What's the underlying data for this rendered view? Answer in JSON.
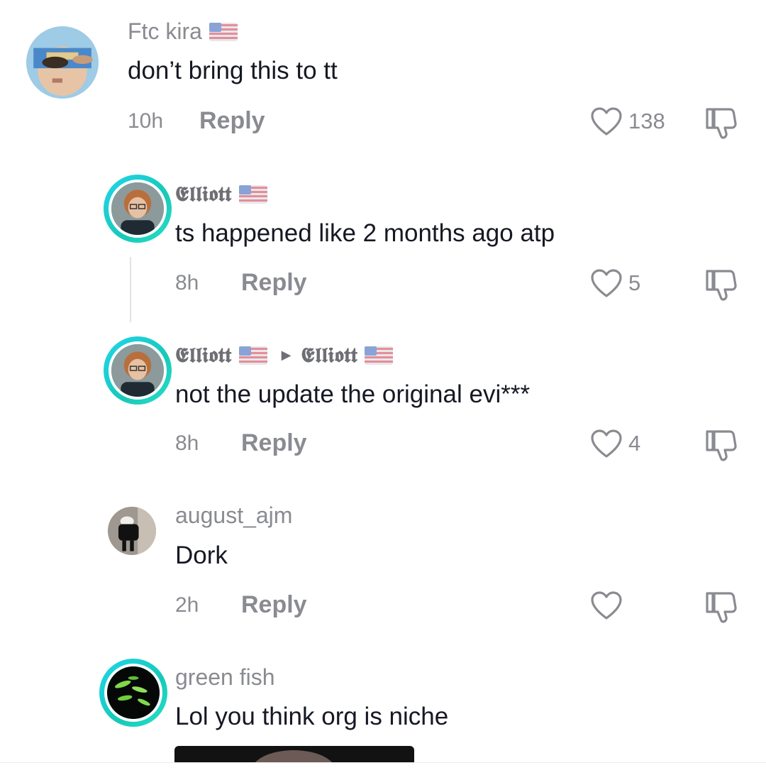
{
  "comments": [
    {
      "username": "Ftc kira",
      "flag": "us-flag",
      "text": "don’t bring this to tt",
      "time": "10h",
      "reply_label": "Reply",
      "likes": "138"
    },
    {
      "username": "𝕰𝖑𝖑𝖎𝖔𝖙𝖙",
      "flag": "us-flag",
      "text": "ts happened like 2 months ago atp",
      "time": "8h",
      "reply_label": "Reply",
      "likes": "5"
    },
    {
      "username": "𝕰𝖑𝖑𝖎𝖔𝖙𝖙",
      "reply_to": "𝕰𝖑𝖑𝖎𝖔𝖙𝖙",
      "flag": "us-flag",
      "text": "not the update the original evi***",
      "time": "8h",
      "reply_label": "Reply",
      "likes": "4"
    },
    {
      "username": "august_ajm",
      "text": "Dork",
      "time": "2h",
      "reply_label": "Reply",
      "likes": ""
    },
    {
      "username": "green fish",
      "text": "Lol you think org is niche"
    }
  ],
  "colors": {
    "text": "#161823",
    "muted": "#8a8b91",
    "story_ring": "#20d5ec",
    "background": "#ffffff"
  },
  "icons": {
    "like": "heart-outline-icon",
    "dislike": "thumbs-down-icon",
    "flag": "us-flag-icon",
    "reply_arrow": "triangle-right-icon"
  }
}
